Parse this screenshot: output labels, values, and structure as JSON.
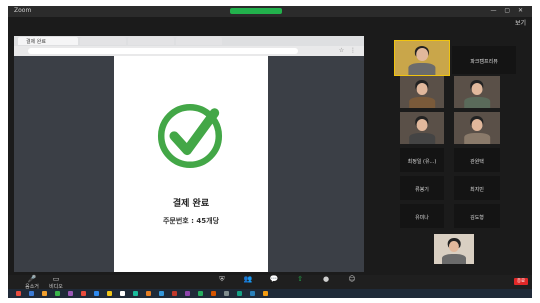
{
  "window": {
    "title": "Zoom",
    "controls": "— ▢ ✕"
  },
  "view_label": "보기",
  "browser": {
    "tabs": [
      "결제 완료",
      "",
      "",
      ""
    ],
    "address": "",
    "icons": "☆ ⋮"
  },
  "document": {
    "page_mark": "",
    "status": "결제 완료",
    "order": "주문번호 : 45개당"
  },
  "participants": [
    {
      "name": "",
      "kind": "video",
      "center": ""
    },
    {
      "name": "",
      "kind": "label",
      "center": "파크캠프리뷰"
    },
    {
      "name": "",
      "kind": "video",
      "center": ""
    },
    {
      "name": "",
      "kind": "video",
      "center": ""
    },
    {
      "name": "",
      "kind": "video",
      "center": ""
    },
    {
      "name": "",
      "kind": "video",
      "center": ""
    },
    {
      "name": "",
      "kind": "label",
      "center": "최정일 (유...)"
    },
    {
      "name": "",
      "kind": "label",
      "center": "관원택"
    },
    {
      "name": "",
      "kind": "label",
      "center": "류봉기"
    },
    {
      "name": "",
      "kind": "label",
      "center": "최지민"
    },
    {
      "name": "",
      "kind": "label",
      "center": "유미나"
    },
    {
      "name": "",
      "kind": "label",
      "center": "김도형"
    },
    {
      "name": "",
      "kind": "video",
      "center": ""
    }
  ],
  "toolbar": {
    "items": [
      {
        "icon": "mic-icon",
        "glyph": "🎤",
        "label": "음소거"
      },
      {
        "icon": "video-icon",
        "glyph": "▭",
        "label": "비디오"
      },
      {
        "icon": "security-icon",
        "glyph": "⛨",
        "label": ""
      },
      {
        "icon": "participants-icon",
        "glyph": "👥",
        "label": ""
      },
      {
        "icon": "chat-icon",
        "glyph": "💬",
        "label": ""
      },
      {
        "icon": "share-icon",
        "glyph": "⇧",
        "label": ""
      },
      {
        "icon": "record-icon",
        "glyph": "●",
        "label": ""
      },
      {
        "icon": "reactions-icon",
        "glyph": "☺",
        "label": ""
      }
    ],
    "end_label": "종료"
  },
  "taskbar": {
    "clock": "",
    "app_colors": [
      "#e84c3d",
      "#3b7bd6",
      "#f0a030",
      "#3ab54a",
      "#9b59b6",
      "#e84c3d",
      "#2d89ef",
      "#f0c419",
      "#ffffff",
      "#1abc9c",
      "#e67e22",
      "#3498db",
      "#c0392b",
      "#8e44ad",
      "#27ae60",
      "#d35400",
      "#7f8c8d",
      "#16a085",
      "#2980b9",
      "#f39c12"
    ]
  },
  "colors": {
    "check_green": "#43a747",
    "end_red": "#e02828",
    "active_green": "#22b14c"
  }
}
